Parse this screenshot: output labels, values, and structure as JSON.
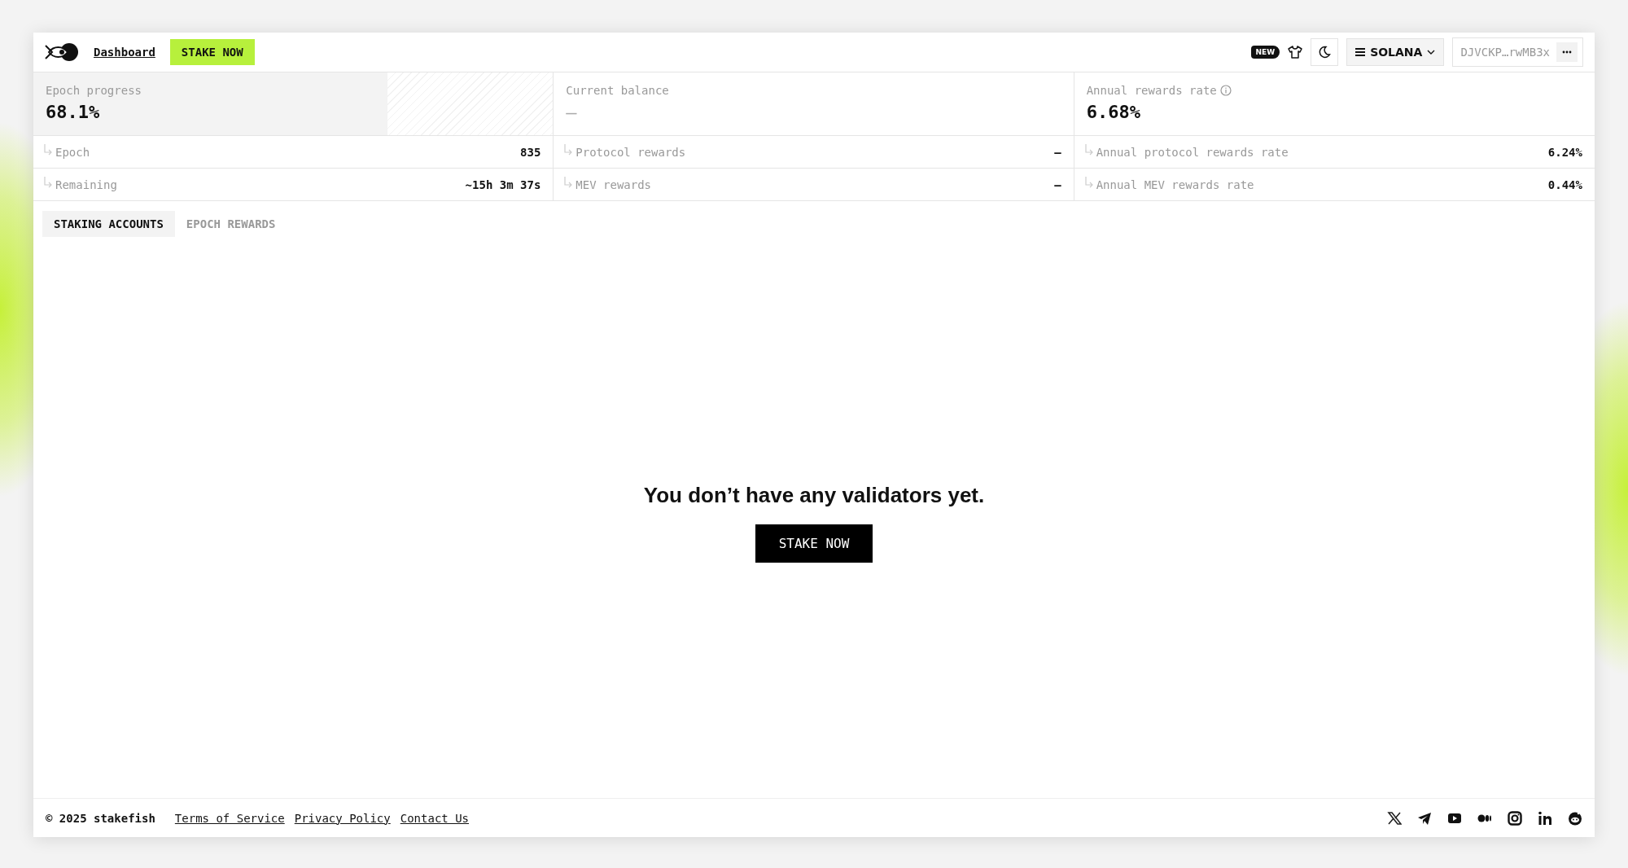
{
  "header": {
    "nav_link": "Dashboard",
    "stake_button": "STAKE NOW",
    "new_badge": "NEW",
    "network": "SOLANA",
    "wallet": "DJVCKP…rwMB3x"
  },
  "stats": [
    {
      "label": "Epoch progress",
      "value": "68.1%",
      "muted": false,
      "level": 0.681,
      "rows": [
        {
          "label": "Epoch",
          "value": "835",
          "muted": false
        },
        {
          "label": "Remaining",
          "value": "~15h 3m 37s",
          "muted": false
        }
      ]
    },
    {
      "label": "Current balance",
      "value": "—",
      "muted": true,
      "rows": [
        {
          "label": "Protocol rewards",
          "value": "–",
          "muted": false
        },
        {
          "label": "MEV rewards",
          "value": "–",
          "muted": false
        }
      ]
    },
    {
      "label": "Annual rewards rate",
      "value": "6.68%",
      "muted": false,
      "info_icon": true,
      "rows": [
        {
          "label": "Annual protocol rewards rate",
          "value": "6.24%",
          "muted": false
        },
        {
          "label": "Annual MEV rewards rate",
          "value": "0.44%",
          "muted": false
        }
      ]
    }
  ],
  "tabs": [
    {
      "label": "STAKING ACCOUNTS",
      "selected": true
    },
    {
      "label": "EPOCH REWARDS",
      "selected": false
    }
  ],
  "empty_state": {
    "message": "You don’t have any validators yet.",
    "button": "STAKE NOW"
  },
  "footer": {
    "copyright": "© 2025 stakefish",
    "links": [
      "Terms of Service",
      "Privacy Policy",
      "Contact Us"
    ]
  }
}
